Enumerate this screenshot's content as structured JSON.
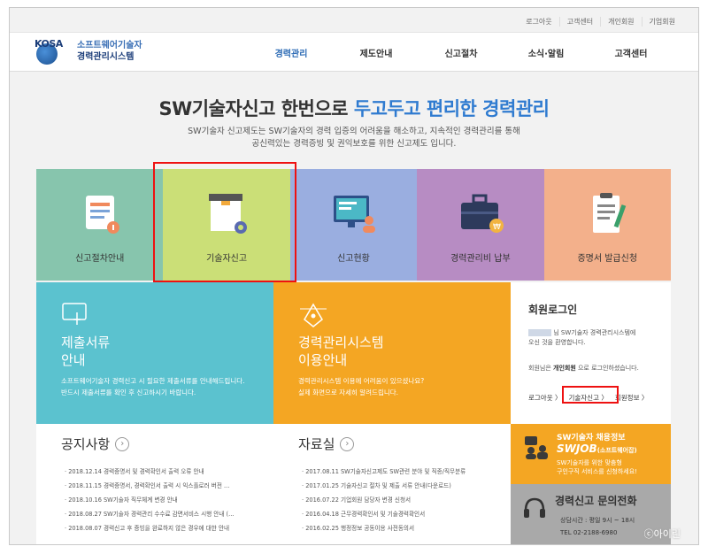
{
  "util_links": [
    "로그아웃",
    "고객센터",
    "개인회원",
    "기업회원"
  ],
  "logo": {
    "mark": "KOSA",
    "line1": "소프트웨어기술자",
    "line2": "경력관리시스템"
  },
  "nav": [
    "경력관리",
    "제도안내",
    "신고절차",
    "소식·알림",
    "고객센터"
  ],
  "hero": {
    "title_a": "SW기술자신고 한번으로 ",
    "title_b": "두고두고 편리한 경력관리",
    "sub1": "SW기술자 신고제도는 SW기술자의 경력 입증의 어려움을 해소하고, 지속적인 경력관리를 통해",
    "sub2": "공신력있는 경력증빙 및 권익보호를 위한 신고제도 입니다."
  },
  "tiles": [
    "신고절차안내",
    "기술자신고",
    "신고현황",
    "경력관리비 납부",
    "증명서 발급신청"
  ],
  "doc_panel": {
    "title1": "제출서류",
    "title2": "안내",
    "desc1": "소프트웨어기술자 경력신고 시 필요한 제출서류를 안내해드립니다.",
    "desc2": "반드시 제출서류를 확인 후 신고하시기 바랍니다."
  },
  "sys_panel": {
    "title1": "경력관리시스템",
    "title2": "이용안내",
    "desc1": "경력관리시스템 이용에 어려움이 있으셨나요?",
    "desc2": "실제 화면으로 자세히 알려드립니다."
  },
  "login": {
    "title": "회원로그인",
    "greet1": "님 SW기술자 경력관리시스템에",
    "greet2": "오신 것을 환영합니다.",
    "status_a": "회원님은 ",
    "status_b": "개인회원",
    "status_c": " 으로 로그인하셨습니다.",
    "links": [
      "로그아웃 〉",
      "기술자신고 〉",
      "회원정보 〉"
    ]
  },
  "notice": {
    "title": "공지사항",
    "rows": [
      {
        "date": "· 2018.12.14",
        "text": "경력증명서 및 경력확인서 출력 오류 안내"
      },
      {
        "date": "· 2018.11.15",
        "text": "경력증명서, 경력확인서 출력 시 익스플로러 버전 ..."
      },
      {
        "date": "· 2018.10.16",
        "text": "SW기술자 직무체계 변경 안내"
      },
      {
        "date": "· 2018.08.27",
        "text": "SW기술자 경력관리 수수료 감면서비스 시행 안내 (..."
      },
      {
        "date": "· 2018.08.07",
        "text": "경력신고 후 증빙을 완료하지 않은 경우에 대한 안내"
      }
    ]
  },
  "data_room": {
    "title": "자료실",
    "rows": [
      {
        "date": "· 2017.08.11",
        "text": "SW기술자신고제도 SW관련 분야 및 직종/직무분류"
      },
      {
        "date": "· 2017.01.25",
        "text": "기술자신고 절차 및 제출 서류 안내(다운로드)"
      },
      {
        "date": "· 2016.07.22",
        "text": "기업회원 담당자 변경 신청서"
      },
      {
        "date": "· 2016.04.18",
        "text": "근무경력확인서 및 기술경력확인서"
      },
      {
        "date": "· 2016.02.25",
        "text": "행정정보 공동이용 사전동의서"
      }
    ]
  },
  "job": {
    "title": "SW기술자 채용정보",
    "logo": "SWJOB",
    "logo_sub": "(소프트웨어잡)",
    "desc1": "SW기술자를 위한 맞춤형",
    "desc2": "구인구직 서비스를 신청하세요!"
  },
  "call": {
    "title": "경력신고 문의전화",
    "hours": "상담시간 : 평일 9시 ~ 18시",
    "tel": "TEL  02-2188-6980"
  },
  "watermark": "ⓒ아이린"
}
